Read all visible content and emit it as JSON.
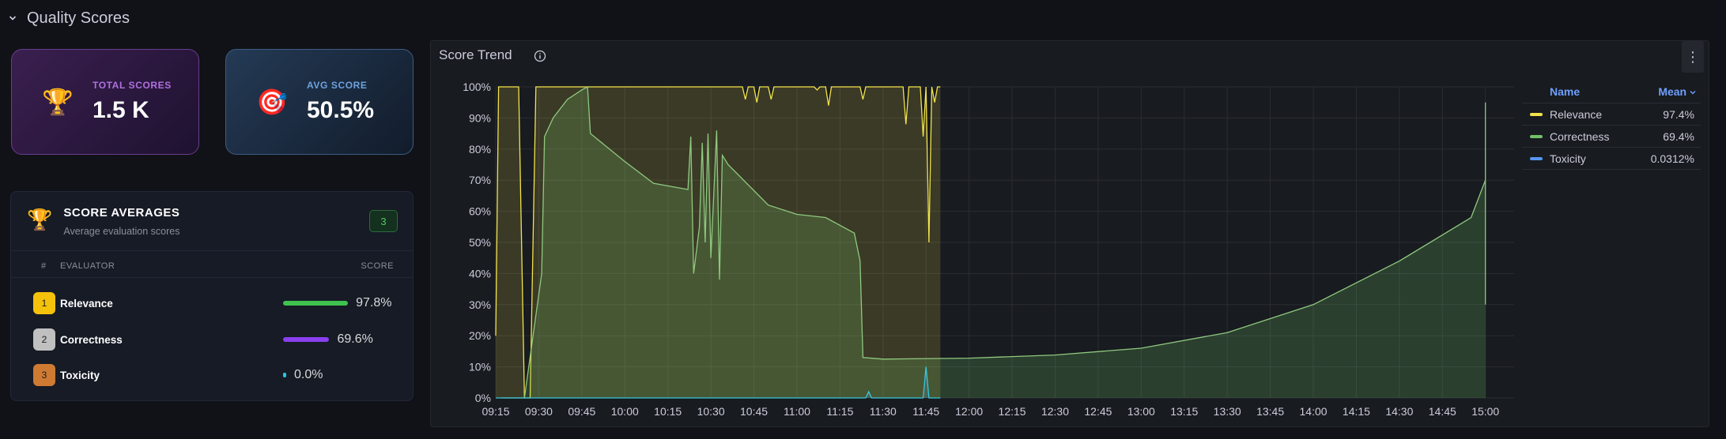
{
  "row": {
    "chevron_icon": "chevron-down",
    "title": "Quality Scores"
  },
  "stats": [
    {
      "icon": "trophy",
      "emoji": "🏆",
      "label": "TOTAL SCORES",
      "value": "1.5 K"
    },
    {
      "icon": "target",
      "emoji": "🎯",
      "label": "AVG SCORE",
      "value": "50.5%"
    }
  ],
  "averages": {
    "icon": "trophy",
    "emoji": "🏆",
    "title": "SCORE AVERAGES",
    "subtitle": "Average evaluation scores",
    "count": "3",
    "columns": {
      "rank": "#",
      "evaluator": "EVALUATOR",
      "score": "SCORE"
    },
    "rows": [
      {
        "rank": "1",
        "name": "Relevance",
        "score": "97.8%",
        "fraction": 0.978,
        "color": "#3fc24f"
      },
      {
        "rank": "2",
        "name": "Correctness",
        "score": "69.6%",
        "fraction": 0.696,
        "color": "#8a3ff0"
      },
      {
        "rank": "3",
        "name": "Toxicity",
        "score": "0.0%",
        "fraction": 0.0,
        "color": "#27c8e0"
      }
    ]
  },
  "trend": {
    "title": "Score Trend",
    "info_icon": "info-circle",
    "menu_icon": "kebab-vertical",
    "legend": {
      "name_header": "Name",
      "mean_header": "Mean",
      "sort_icon": "chevron-down",
      "items": [
        {
          "name": "Relevance",
          "mean": "97.4%",
          "color": "#f2e34a"
        },
        {
          "name": "Correctness",
          "mean": "69.4%",
          "color": "#73bf69"
        },
        {
          "name": "Toxicity",
          "mean": "0.0312%",
          "color": "#5794f2"
        }
      ]
    }
  },
  "chart_data": {
    "type": "area",
    "title": "Score Trend",
    "xlabel": "",
    "ylabel": "",
    "ylim": [
      0,
      100
    ],
    "ytick_labels": [
      "0%",
      "10%",
      "20%",
      "30%",
      "40%",
      "50%",
      "60%",
      "70%",
      "80%",
      "90%",
      "100%"
    ],
    "xtick_labels": [
      "09:15",
      "09:30",
      "09:45",
      "10:00",
      "10:15",
      "10:30",
      "10:45",
      "11:00",
      "11:15",
      "11:30",
      "11:45",
      "12:00",
      "12:15",
      "12:30",
      "12:45",
      "13:00",
      "13:15",
      "13:30",
      "13:45",
      "14:00",
      "14:15",
      "14:30",
      "14:45",
      "15:00"
    ],
    "x_start": "09:15",
    "x_end": "15:10",
    "grid": true,
    "legend_position": "right",
    "series": [
      {
        "name": "Relevance",
        "color": "#f2e34a",
        "points": [
          [
            "09:15",
            20
          ],
          [
            "09:16",
            100
          ],
          [
            "09:23",
            100
          ],
          [
            "09:25",
            0
          ],
          [
            "09:27",
            0
          ],
          [
            "09:29",
            100
          ],
          [
            "10:41",
            100
          ],
          [
            "10:42",
            96
          ],
          [
            "10:43",
            100
          ],
          [
            "10:45",
            100
          ],
          [
            "10:46",
            95
          ],
          [
            "10:47",
            100
          ],
          [
            "10:50",
            100
          ],
          [
            "10:51",
            96
          ],
          [
            "10:52",
            100
          ],
          [
            "11:06",
            100
          ],
          [
            "11:07",
            99
          ],
          [
            "11:08",
            100
          ],
          [
            "11:10",
            100
          ],
          [
            "11:11",
            94
          ],
          [
            "11:12",
            100
          ],
          [
            "11:22",
            100
          ],
          [
            "11:23",
            96
          ],
          [
            "11:24",
            100
          ],
          [
            "11:37",
            100
          ],
          [
            "11:38",
            88
          ],
          [
            "11:39",
            100
          ],
          [
            "11:43",
            100
          ],
          [
            "11:44",
            84
          ],
          [
            "11:45",
            100
          ],
          [
            "11:46",
            50
          ],
          [
            "11:47",
            100
          ],
          [
            "11:48",
            95
          ],
          [
            "11:49",
            100
          ],
          [
            "11:50",
            100
          ]
        ]
      },
      {
        "name": "Correctness",
        "color": "#73bf69",
        "points": [
          [
            "09:17",
            0
          ],
          [
            "09:25",
            0
          ],
          [
            "09:31",
            40
          ],
          [
            "09:32",
            84
          ],
          [
            "09:35",
            90
          ],
          [
            "09:40",
            96
          ],
          [
            "09:45",
            99
          ],
          [
            "09:47",
            100
          ],
          [
            "09:48",
            85
          ],
          [
            "10:00",
            76
          ],
          [
            "10:10",
            69
          ],
          [
            "10:22",
            67
          ],
          [
            "10:23",
            84
          ],
          [
            "10:24",
            40
          ],
          [
            "10:26",
            55
          ],
          [
            "10:27",
            82
          ],
          [
            "10:28",
            50
          ],
          [
            "10:29",
            85
          ],
          [
            "10:30",
            45
          ],
          [
            "10:32",
            86
          ],
          [
            "10:33",
            38
          ],
          [
            "10:34",
            78
          ],
          [
            "10:36",
            75
          ],
          [
            "10:50",
            62
          ],
          [
            "11:00",
            59
          ],
          [
            "11:10",
            58
          ],
          [
            "11:20",
            53
          ],
          [
            "11:22",
            44
          ],
          [
            "11:23",
            13
          ],
          [
            "11:30",
            12.5
          ],
          [
            "12:00",
            12.8
          ],
          [
            "12:30",
            13.8
          ],
          [
            "13:00",
            16
          ],
          [
            "13:30",
            21
          ],
          [
            "14:00",
            30
          ],
          [
            "14:30",
            44
          ],
          [
            "14:55",
            58
          ],
          [
            "15:00",
            70
          ],
          [
            "15:00",
            95
          ],
          [
            "15:00",
            30
          ]
        ]
      },
      {
        "name": "Toxicity",
        "color": "#5794f2",
        "points": [
          [
            "09:15",
            0
          ],
          [
            "11:24",
            0
          ],
          [
            "11:25",
            2
          ],
          [
            "11:26",
            0
          ],
          [
            "11:44",
            0
          ],
          [
            "11:45",
            10
          ],
          [
            "11:46",
            0
          ],
          [
            "11:50",
            0
          ]
        ]
      }
    ]
  }
}
